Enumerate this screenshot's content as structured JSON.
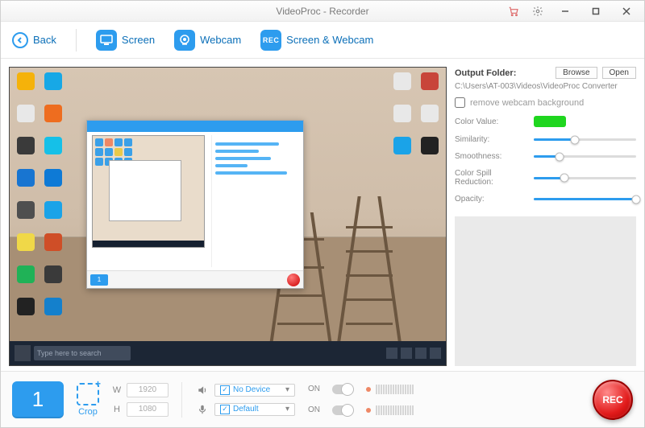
{
  "title": "VideoProc - Recorder",
  "nav": {
    "back": "Back",
    "screen": "Screen",
    "webcam": "Webcam",
    "screen_webcam": "Screen & Webcam"
  },
  "preview": {
    "taskbar_search": "Type here to search"
  },
  "settings": {
    "output_folder_label": "Output Folder:",
    "browse": "Browse",
    "open": "Open",
    "path": "C:\\Users\\AT-003\\Videos\\VideoProc Converter",
    "remove_bg": "remove webcam background",
    "color_value": "Color Value:",
    "similarity": "Similarity:",
    "smoothness": "Smoothness:",
    "spill": "Color Spill Reduction:",
    "opacity": "Opacity:",
    "sliders": {
      "similarity": 40,
      "smoothness": 25,
      "spill": 30,
      "opacity": 100
    },
    "color_hex": "#1fd61f"
  },
  "footer": {
    "display_number": "1",
    "crop": "Crop",
    "w_label": "W",
    "h_label": "H",
    "w_value": "1920",
    "h_value": "1080",
    "speaker_device": "No Device",
    "mic_device": "Default",
    "toggle_on": "ON",
    "rec": "REC"
  }
}
